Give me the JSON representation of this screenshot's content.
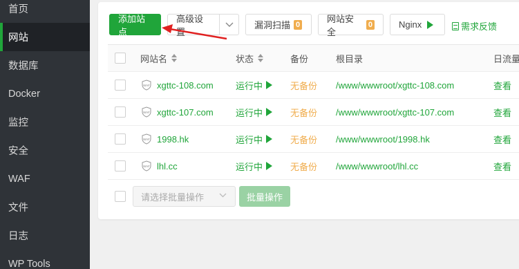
{
  "sidebar": {
    "items": [
      {
        "label": "首页",
        "active": false
      },
      {
        "label": "网站",
        "active": true
      },
      {
        "label": "数据库",
        "active": false
      },
      {
        "label": "Docker",
        "active": false
      },
      {
        "label": "监控",
        "active": false
      },
      {
        "label": "安全",
        "active": false
      },
      {
        "label": "WAF",
        "active": false
      },
      {
        "label": "文件",
        "active": false
      },
      {
        "label": "日志",
        "active": false
      },
      {
        "label": "WP Tools",
        "active": false
      }
    ]
  },
  "toolbar": {
    "add_site": "添加站点",
    "advanced": "高级设置",
    "vuln_scan": "漏洞扫描",
    "vuln_count": "0",
    "site_security": "网站安全",
    "security_count": "0",
    "nginx": "Nginx",
    "feedback": "需求反馈"
  },
  "table": {
    "headers": {
      "name": "网站名",
      "status": "状态",
      "backup": "备份",
      "root": "根目录",
      "traffic": "日流量"
    },
    "rows": [
      {
        "name": "xgttc-108.com",
        "status": "运行中",
        "backup": "无备份",
        "root": "/www/wwwroot/xgttc-108.com",
        "action": "查看"
      },
      {
        "name": "xgttc-107.com",
        "status": "运行中",
        "backup": "无备份",
        "root": "/www/wwwroot/xgttc-107.com",
        "action": "查看"
      },
      {
        "name": "1998.hk",
        "status": "运行中",
        "backup": "无备份",
        "root": "/www/wwwroot/1998.hk",
        "action": "查看"
      },
      {
        "name": "lhl.cc",
        "status": "运行中",
        "backup": "无备份",
        "root": "/www/wwwroot/lhl.cc",
        "action": "查看"
      }
    ]
  },
  "batch": {
    "placeholder": "请选择批量操作",
    "button": "批量操作"
  },
  "colors": {
    "brand_green": "#20a53a",
    "warning_orange": "#f0ad4e",
    "annotation_red": "#e02020",
    "sidebar_bg": "#2f3338"
  }
}
